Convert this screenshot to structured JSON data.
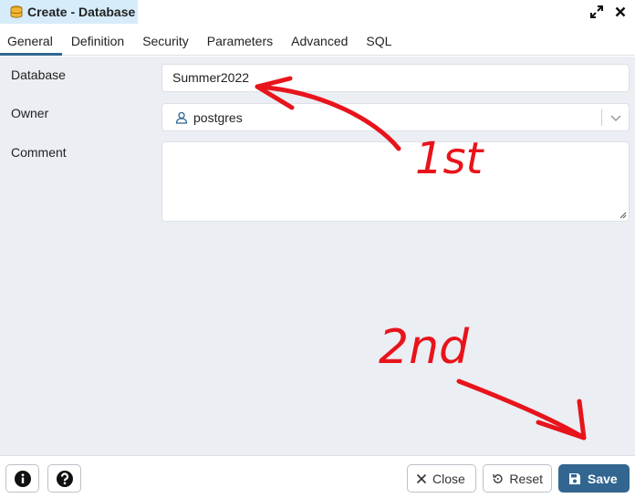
{
  "window": {
    "title": "Create - Database",
    "icons": [
      "database-icon",
      "expand-icon",
      "close-icon"
    ]
  },
  "tabs": [
    {
      "label": "General",
      "active": true
    },
    {
      "label": "Definition",
      "active": false
    },
    {
      "label": "Security",
      "active": false
    },
    {
      "label": "Parameters",
      "active": false
    },
    {
      "label": "Advanced",
      "active": false
    },
    {
      "label": "SQL",
      "active": false
    }
  ],
  "form": {
    "database_label": "Database",
    "database_value": "Summer2022",
    "owner_label": "Owner",
    "owner_value": "postgres",
    "comment_label": "Comment",
    "comment_value": ""
  },
  "annotations": {
    "first": "1st",
    "second": "2nd",
    "color": "#e8141b"
  },
  "footer": {
    "close_label": "Close",
    "reset_label": "Reset",
    "save_label": "Save",
    "icons": [
      "info-icon",
      "help-icon",
      "x-icon",
      "reset-icon",
      "save-icon"
    ]
  },
  "colors": {
    "accent": "#326690",
    "title_tab_bg": "#d6ecfb",
    "body_bg": "#ebeef3"
  }
}
